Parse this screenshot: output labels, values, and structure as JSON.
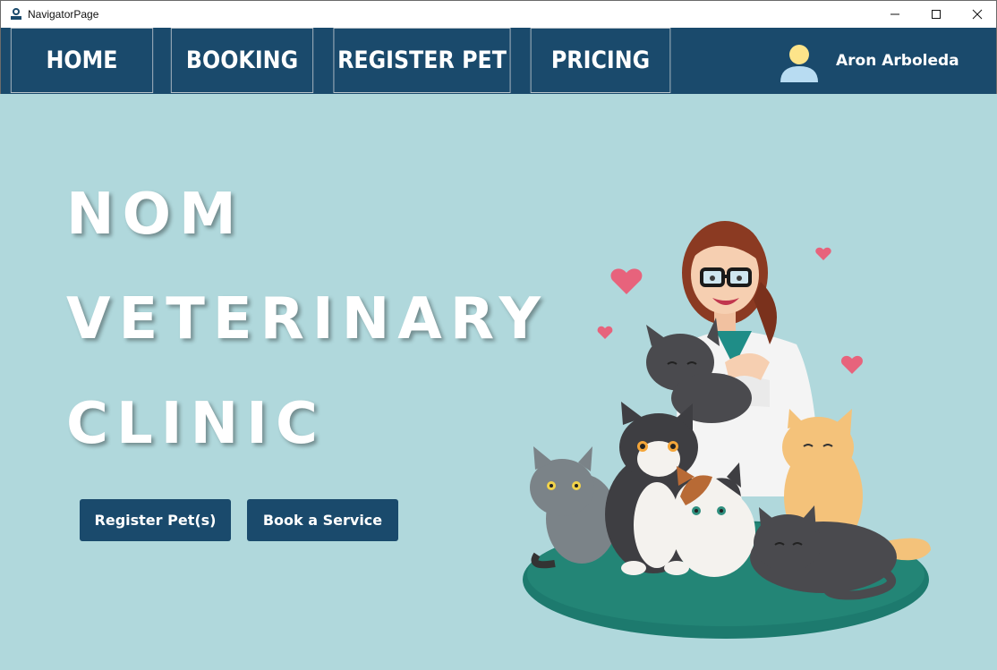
{
  "window": {
    "title": "NavigatorPage",
    "icon": "nom-clinic-logo-icon"
  },
  "nav": {
    "home": "HOME",
    "booking": "BOOKING",
    "register_pet": "REGISTER PET",
    "pricing": "PRICING",
    "user_name": "Aron Arboleda",
    "user_icon": "user-avatar-icon"
  },
  "hero": {
    "line1": "NOM",
    "line2": "VETERINARY",
    "line3": "CLINIC",
    "register_button": "Register Pet(s)",
    "book_button": "Book a Service"
  },
  "colors": {
    "background": "#b0d8dc",
    "nav": "#1a4a6c",
    "accent_button": "#1a4a6c",
    "text": "#ffffff"
  }
}
